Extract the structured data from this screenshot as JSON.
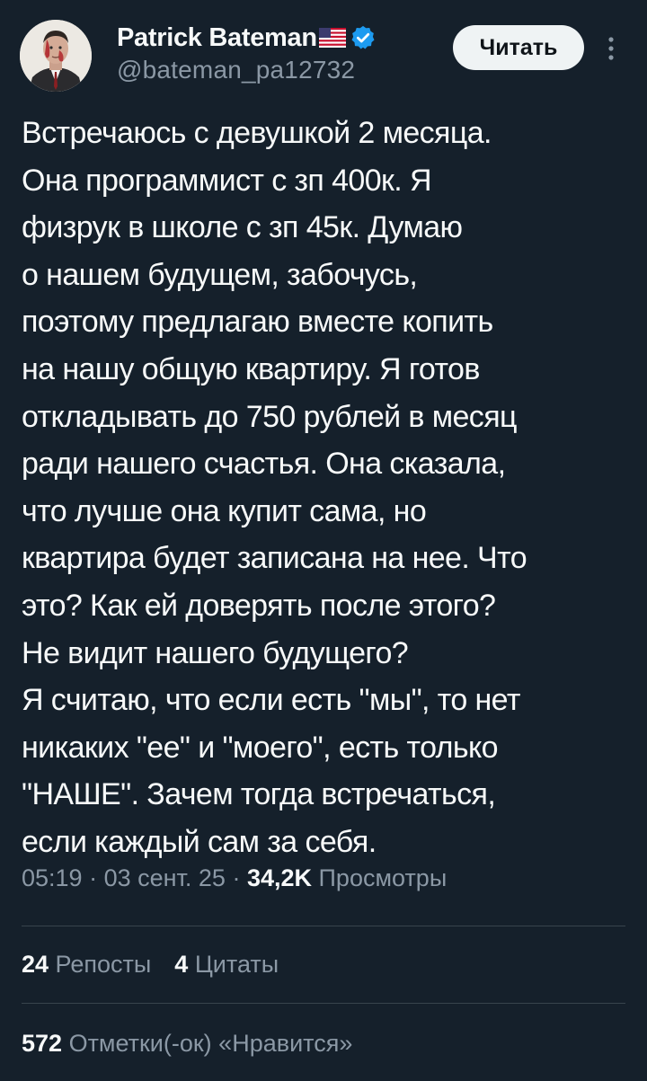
{
  "author": {
    "display_name": "Patrick Bateman",
    "flag": "🇺🇸",
    "handle": "@bateman_pa12732",
    "verified": true
  },
  "header": {
    "follow_label": "Читать",
    "more_icon": "more-vertical-icon"
  },
  "tweet": {
    "text": "Встречаюсь с девушкой 2 месяца.\nОна программист с зп 400к. Я\nфизрук в школе с зп 45к. Думаю\nо нашем будущем, забочусь,\nпоэтому предлагаю вместе копить\nна нашу общую квартиру. Я готов\nоткладывать до 750 рублей в месяц\nради нашего счастья. Она сказала,\nчто лучше она купит сама, но\nквартира будет записана на нее. Что\nэто? Как ей доверять после этого?\nНе видит нашего будущего?\nЯ считаю, что если есть \"мы\", то нет\nникаких \"ее\" и \"моего\", есть только\n\"НАШЕ\". Зачем тогда встречаться,\nесли каждый сам за себя."
  },
  "meta": {
    "time": "05:19",
    "separator": " · ",
    "date": "03 сент. 25",
    "views_count": "34,2K",
    "views_label": " Просмотры"
  },
  "stats": {
    "reposts_count": "24",
    "reposts_label": " Репосты",
    "quotes_count": "4",
    "quotes_label": " Цитаты",
    "likes_count": "572",
    "likes_label": " Отметки(-ок) «Нравится»"
  },
  "colors": {
    "background": "#15202b",
    "text": "#f7f9f9",
    "secondary": "#8b98a5",
    "verified": "#1d9bf0",
    "button_bg": "#eff3f4",
    "divider": "#38444d"
  }
}
